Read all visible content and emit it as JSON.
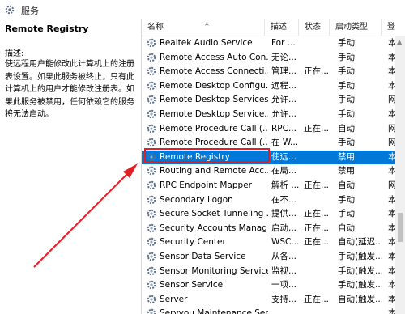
{
  "window": {
    "title": "服务"
  },
  "left_panel": {
    "service_name": "Remote Registry",
    "description_label": "描述:",
    "description": "使远程用户能修改此计算机上的注册表设置。如果此服务被终止，只有此计算机上的用户才能修改注册表。如果此服务被禁用，任何依赖它的服务将无法启动。"
  },
  "columns": {
    "name": "名称",
    "description": "描述",
    "status": "状态",
    "startup": "启动类型",
    "logon": "登"
  },
  "rows": [
    {
      "name": "Realtek Audio Service",
      "description": "For ...",
      "status": "",
      "startup": "手动",
      "logon": "本"
    },
    {
      "name": "Remote Access Auto Con...",
      "description": "无论...",
      "status": "",
      "startup": "手动",
      "logon": "本"
    },
    {
      "name": "Remote Access Connecti...",
      "description": "管理...",
      "status": "正在...",
      "startup": "手动",
      "logon": "本"
    },
    {
      "name": "Remote Desktop Configu...",
      "description": "远程...",
      "status": "",
      "startup": "手动",
      "logon": "本"
    },
    {
      "name": "Remote Desktop Services",
      "description": "允许...",
      "status": "",
      "startup": "手动",
      "logon": "网"
    },
    {
      "name": "Remote Desktop Service...",
      "description": "允许...",
      "status": "",
      "startup": "手动",
      "logon": "本"
    },
    {
      "name": "Remote Procedure Call (...",
      "description": "RPC...",
      "status": "正在...",
      "startup": "自动",
      "logon": "网"
    },
    {
      "name": "Remote Procedure Call (...",
      "description": "在 W...",
      "status": "",
      "startup": "手动",
      "logon": "网"
    },
    {
      "name": "Remote Registry",
      "description": "使远...",
      "status": "",
      "startup": "禁用",
      "logon": "本",
      "selected": true
    },
    {
      "name": "Routing and Remote Acc...",
      "description": "在局...",
      "status": "",
      "startup": "禁用",
      "logon": "本"
    },
    {
      "name": "RPC Endpoint Mapper",
      "description": "解析 ...",
      "status": "正在...",
      "startup": "自动",
      "logon": "网"
    },
    {
      "name": "Secondary Logon",
      "description": "在不...",
      "status": "",
      "startup": "手动",
      "logon": "本"
    },
    {
      "name": "Secure Socket Tunneling ...",
      "description": "提供...",
      "status": "正在...",
      "startup": "手动",
      "logon": "本"
    },
    {
      "name": "Security Accounts Manag...",
      "description": "启动...",
      "status": "正在...",
      "startup": "自动",
      "logon": "本"
    },
    {
      "name": "Security Center",
      "description": "WSC...",
      "status": "正在...",
      "startup": "自动(延迟...",
      "logon": "本"
    },
    {
      "name": "Sensor Data Service",
      "description": "从各...",
      "status": "",
      "startup": "手动(触发...",
      "logon": "本"
    },
    {
      "name": "Sensor Monitoring Service",
      "description": "监视...",
      "status": "",
      "startup": "手动(触发...",
      "logon": "本"
    },
    {
      "name": "Sensor Service",
      "description": "一项...",
      "status": "",
      "startup": "手动(触发...",
      "logon": "本"
    },
    {
      "name": "Server",
      "description": "支持...",
      "status": "正在...",
      "startup": "自动(触发...",
      "logon": "本"
    },
    {
      "name": "Servyou Maintenance Ser...",
      "description": "...",
      "status": "",
      "startup": "...",
      "logon": "本"
    }
  ],
  "colors": {
    "selection": "#0078d7",
    "annotation": "#e01f25"
  }
}
